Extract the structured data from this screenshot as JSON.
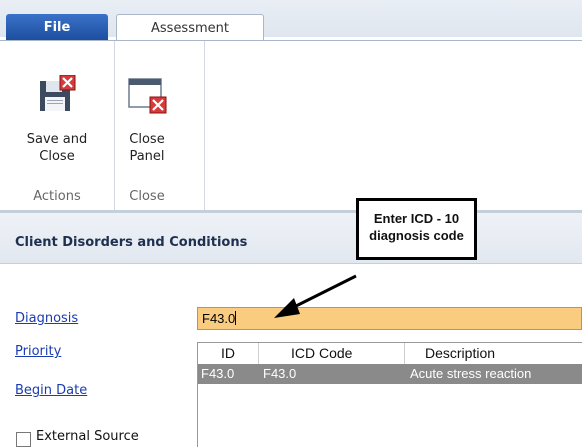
{
  "tabs": {
    "file": "File",
    "assessment": "Assessment"
  },
  "ribbon": {
    "save_close_line1": "Save and",
    "save_close_line2": "Close",
    "close_panel_line1": "Close",
    "close_panel_line2": "Panel",
    "group_actions": "Actions",
    "group_close": "Close"
  },
  "panel": {
    "title": "Client Disorders and Conditions"
  },
  "form": {
    "diagnosis_label": "Diagnosis",
    "diagnosis_value": "F43.0",
    "priority_label": "Priority",
    "begin_date_label": "Begin Date",
    "external_source_label": "External Source"
  },
  "grid": {
    "columns": [
      "ID",
      "ICD Code",
      "Description"
    ],
    "rows": [
      {
        "id": "F43.0",
        "icd_code": "F43.0",
        "description": "Acute stress reaction"
      }
    ]
  },
  "callout": {
    "line1": "Enter ICD - 10",
    "line2": "diagnosis code"
  },
  "colors": {
    "file_tab": "#2a5fb5",
    "input_highlight": "#f9cc80",
    "selected_row": "#8a8a8a",
    "link": "#1a3cb0"
  }
}
